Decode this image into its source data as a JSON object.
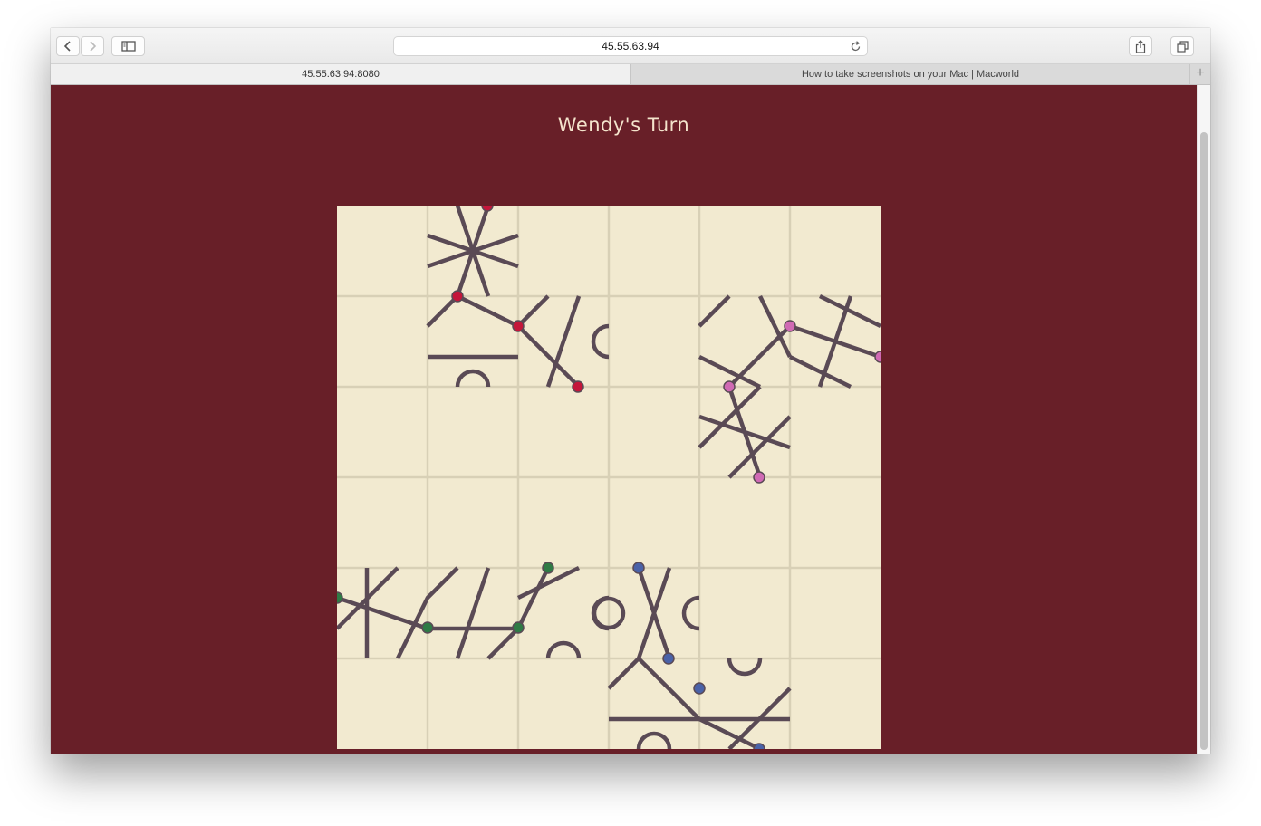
{
  "toolbar": {
    "url": "45.55.63.94",
    "icons": [
      "back-icon",
      "forward-icon",
      "sidebar-icon",
      "reload-icon",
      "share-icon",
      "tabs-overview-icon"
    ]
  },
  "tabs": [
    {
      "label": "45.55.63.94:8080",
      "active": true
    },
    {
      "label": "How to take screenshots on your Mac | Macworld",
      "active": false
    }
  ],
  "game": {
    "turn_label": "Wendy's Turn",
    "board_grid": "6x6",
    "colors": {
      "page_background": "#681f28",
      "board_background": "#f2ead0",
      "track": "#5a4a55",
      "player_red": "#c4163a",
      "player_pink": "#d06ab4",
      "player_green": "#2f7a45",
      "player_blue": "#4a62a8"
    }
  }
}
